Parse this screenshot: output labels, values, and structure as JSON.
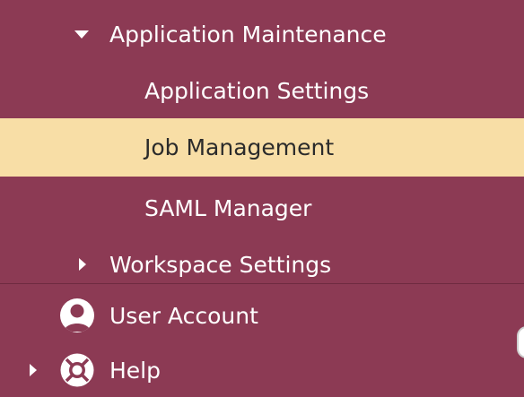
{
  "menu": {
    "application_maintenance": {
      "label": "Application Maintenance",
      "expanded": true
    },
    "application_settings": {
      "label": "Application Settings"
    },
    "job_management": {
      "label": "Job Management",
      "selected": true
    },
    "saml_manager": {
      "label": "SAML Manager"
    },
    "workspace_settings": {
      "label": "Workspace Settings",
      "expanded": false
    },
    "user_account": {
      "label": "User Account",
      "icon": "user-circle-icon"
    },
    "help": {
      "label": "Help",
      "icon": "lifebuoy-icon",
      "expanded": false
    }
  },
  "colors": {
    "background": "#8c3a54",
    "selected_background": "#f8dea6",
    "text": "#ffffff",
    "selected_text": "#2b2b2b"
  }
}
